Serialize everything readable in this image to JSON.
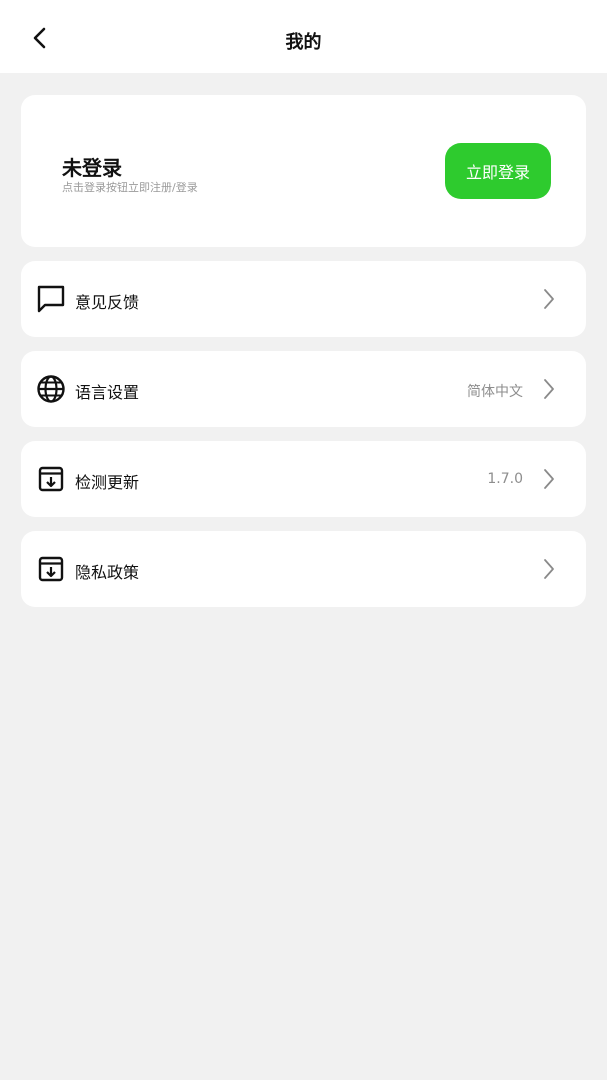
{
  "header": {
    "title": "我的",
    "back_icon": "chevron-left-icon"
  },
  "login": {
    "title": "未登录",
    "subtitle": "点击登录按钮立即注册/登录",
    "button_label": "立即登录",
    "button_color": "#2ecb2e"
  },
  "menu": [
    {
      "label": "意见反馈",
      "value": "",
      "icon": "chat-bubble-icon"
    },
    {
      "label": "语言设置",
      "value": "简体中文",
      "icon": "globe-icon"
    },
    {
      "label": "检测更新",
      "value": "1.7.0",
      "icon": "download-box-icon"
    },
    {
      "label": "隐私政策",
      "value": "",
      "icon": "download-box-icon"
    }
  ],
  "colors": {
    "background": "#f1f1f1",
    "card": "#ffffff",
    "secondary_text": "#8e8e8e"
  }
}
